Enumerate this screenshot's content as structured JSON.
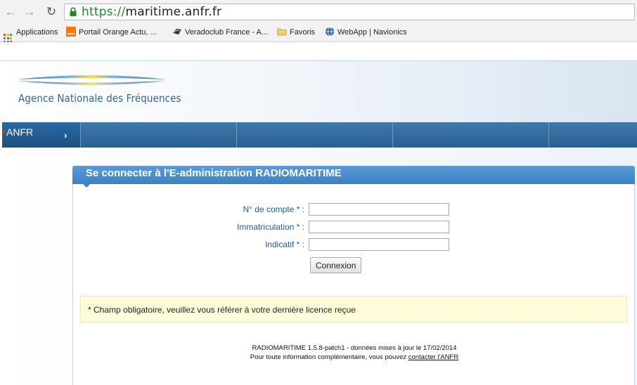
{
  "browser": {
    "url_scheme": "https://",
    "url_host": "maritime.anfr.fr",
    "bookmarks": [
      {
        "label": "Applications"
      },
      {
        "label": "Portail Orange  Actu, ..."
      },
      {
        "label": "Veradoclub France - A..."
      },
      {
        "label": "Favoris"
      },
      {
        "label": "WebApp | Navionics"
      }
    ]
  },
  "header": {
    "org_name": "Agence Nationale des Fréquences"
  },
  "navbar": {
    "home_label": "ANFR",
    "home_arrow": "›"
  },
  "login": {
    "title": "Se connecter à l'E-administration RADIOMARITIME",
    "fields": [
      {
        "label": "N° de compte * :",
        "value": ""
      },
      {
        "label": "Immatriculation * :",
        "value": ""
      },
      {
        "label": "Indicatif * :",
        "value": ""
      }
    ],
    "submit_label": "Connexion",
    "notice": "* Champ obligatoire, veuillez vous référer à votre dernière licence reçue"
  },
  "footer": {
    "version_line": "RADIOMARITIME 1.5.8-patch1 - données mises à jour le 17/02/2014",
    "info_prefix": "Pour toute information complémentaire, vous pouvez ",
    "contact_link": "contacter l'ANFR"
  },
  "colors": {
    "accent": "#3b82c4",
    "navbar": "#2a5f91",
    "label_blue": "#1f5d99",
    "notice_bg": "#fffdd9"
  }
}
